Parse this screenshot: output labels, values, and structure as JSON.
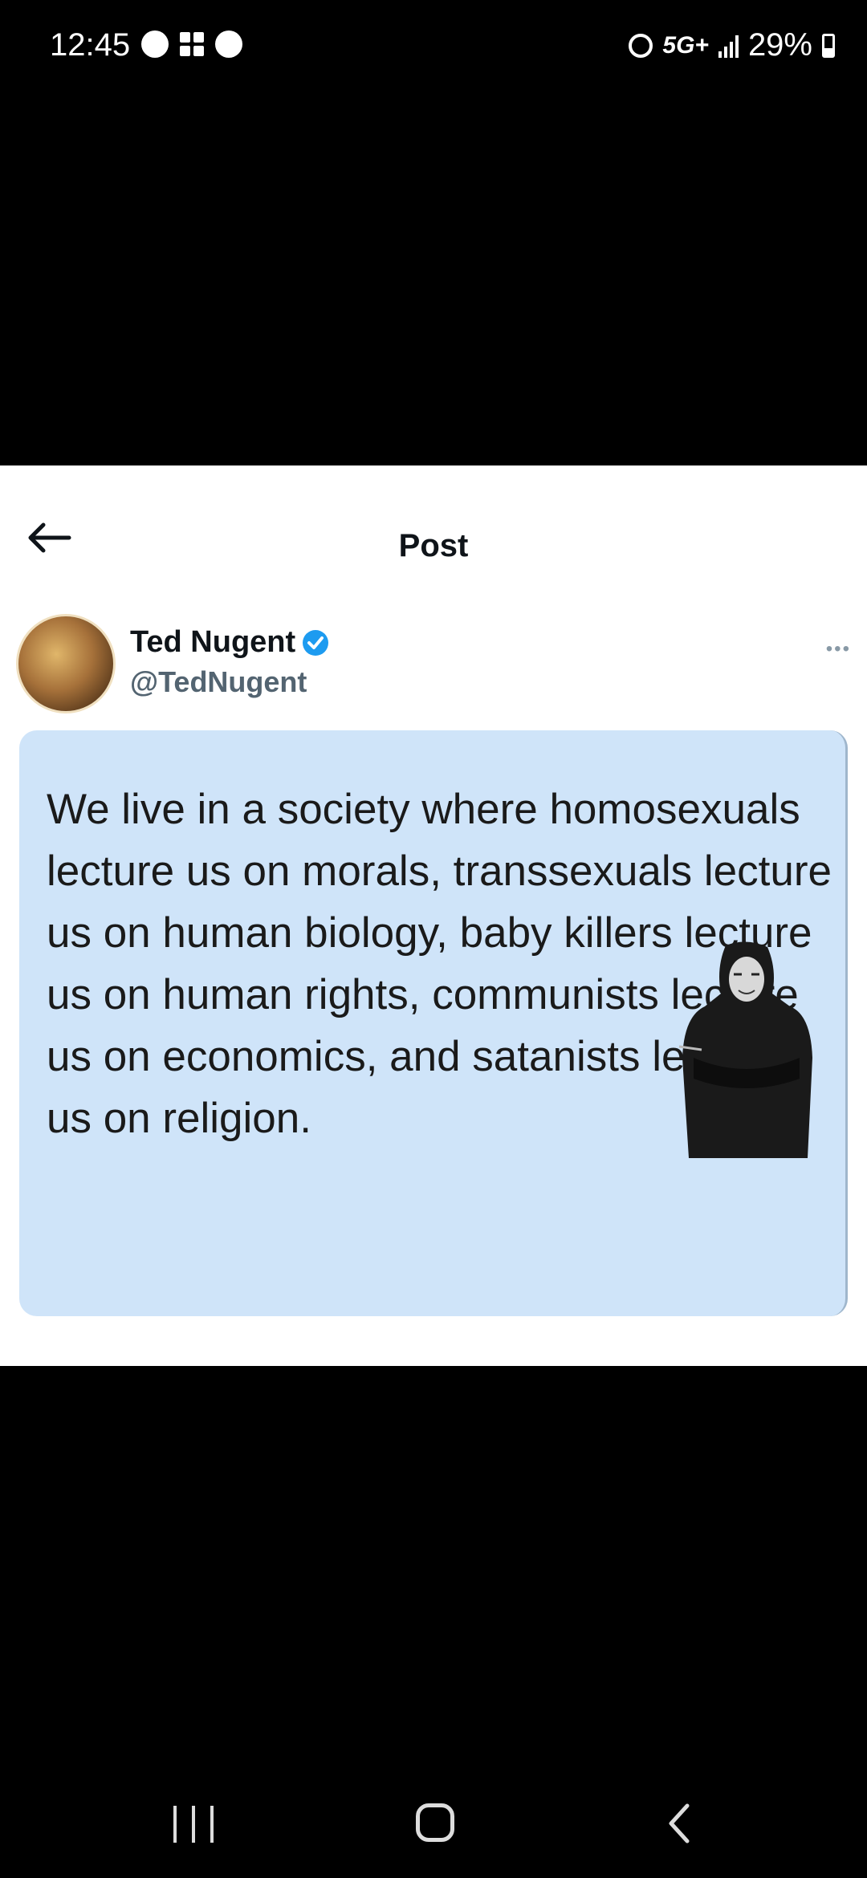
{
  "status_bar": {
    "time": "12:45",
    "network": "5G+",
    "battery": "29%",
    "icons": [
      "messenger-icon",
      "app-grid-icon",
      "game-icon",
      "alarm-icon",
      "signal-icon",
      "battery-icon"
    ]
  },
  "post": {
    "header_title": "Post",
    "author_name": "Ted Nugent",
    "author_handle": "@TedNugent",
    "more_label": "•••",
    "text": "We live in a society where homosexuals lecture us on morals, transsexuals lecture us on human biology, baby killers lecture us on human rights, communists lecture us on economics, and satanists lecture us on religion."
  },
  "colors": {
    "accent_blue": "#1d9bf0",
    "card_background": "#cfe4f9",
    "background": "#000000"
  }
}
